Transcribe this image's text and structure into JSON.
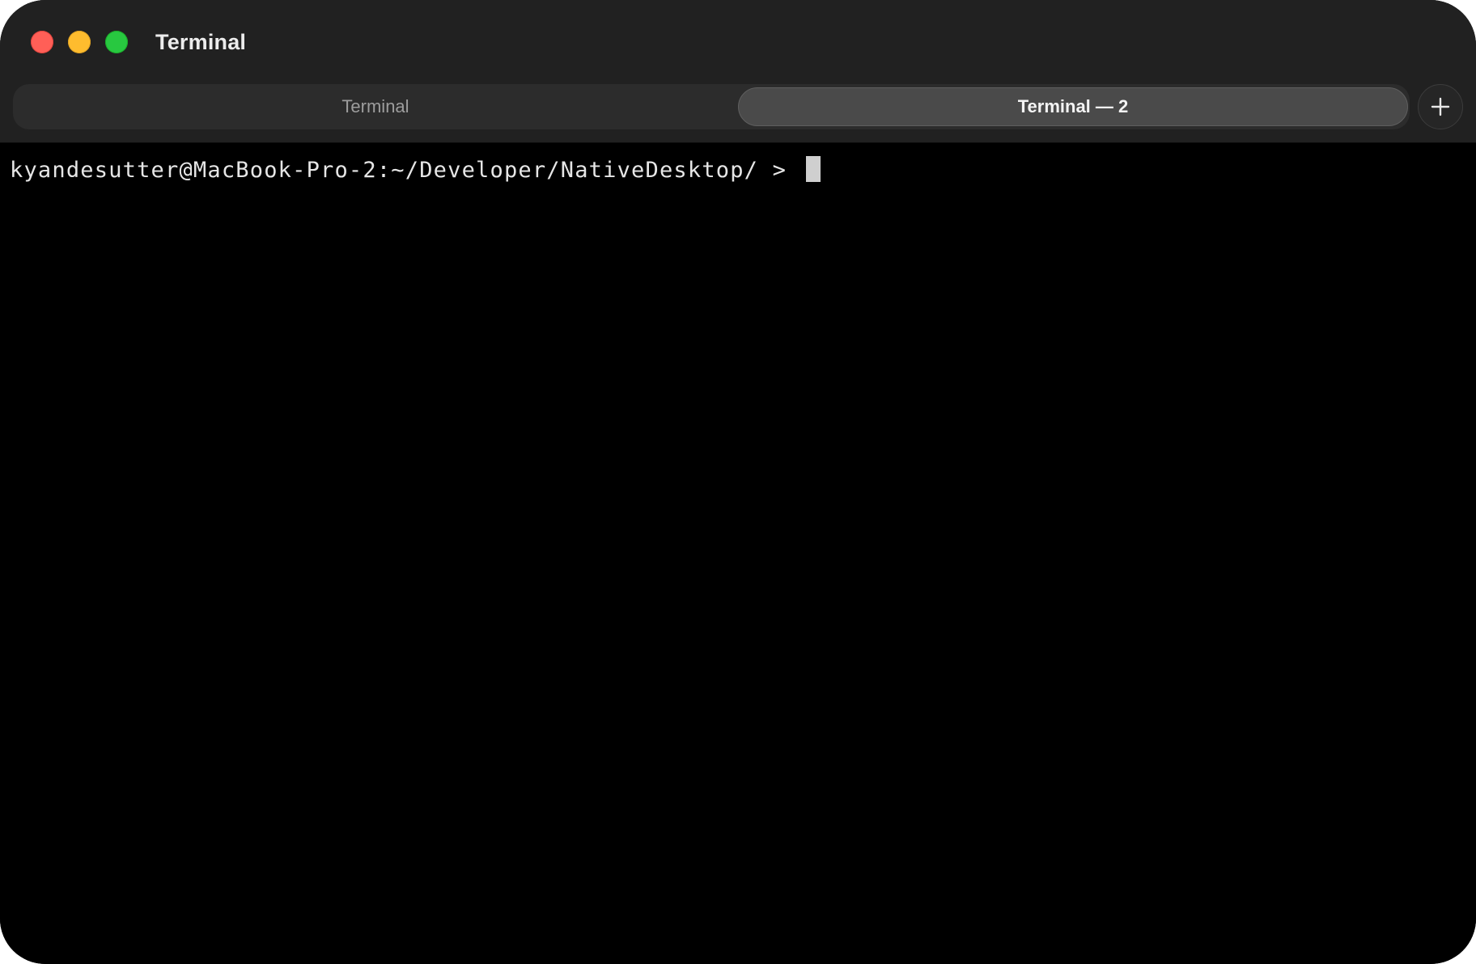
{
  "window": {
    "title": "Terminal",
    "controls": {
      "close_color": "#ff5f57",
      "minimize_color": "#febc2e",
      "zoom_color": "#28c840"
    }
  },
  "tabs": [
    {
      "label": "Terminal",
      "active": false
    },
    {
      "label": "Terminal — 2",
      "active": true
    }
  ],
  "new_tab_icon": "plus-icon",
  "terminal": {
    "prompt": "kyandesutter@MacBook-Pro-2:~/Developer/NativeDesktop/ > ",
    "background": "#000000",
    "text_color": "#e6e6e6"
  }
}
